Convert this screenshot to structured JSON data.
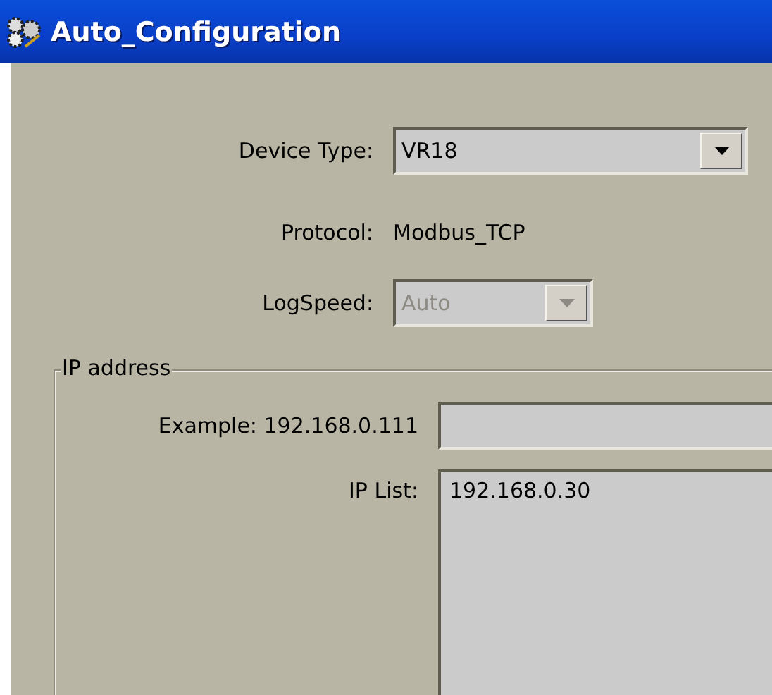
{
  "window": {
    "title": "Auto_Configuration"
  },
  "device_type": {
    "label": "Device Type:",
    "value": "VR18",
    "disabled": false
  },
  "protocol": {
    "label": "Protocol:",
    "value": "Modbus_TCP"
  },
  "log_speed": {
    "label": "LogSpeed:",
    "value": "Auto",
    "disabled": true
  },
  "ip_address": {
    "title": "IP address",
    "example": {
      "label": "Example: 192.168.0.111"
    },
    "ip_list": {
      "label": "IP List:",
      "items": [
        "192.168.0.30"
      ]
    }
  }
}
